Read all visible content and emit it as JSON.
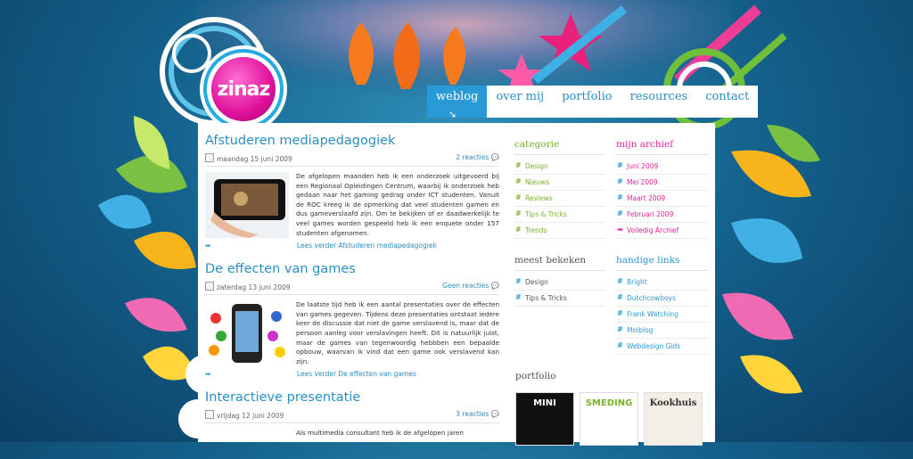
{
  "logo": "zinaz",
  "nav": [
    {
      "label": "weblog",
      "active": true
    },
    {
      "label": "over mij"
    },
    {
      "label": "portfolio"
    },
    {
      "label": "resources"
    },
    {
      "label": "contact"
    }
  ],
  "posts": [
    {
      "title": "Afstuderen mediapedagogiek",
      "date": "maandag 15 juni 2009",
      "reactions": "2 reacties",
      "text": "De afgelopen maanden heb ik een onderzoek uitgevoerd bij een Regionaal Opleidingen Centrum, waarbij ik onderzoek heb gedaan naar het gaming gedrag onder ICT studenten. Vanuit de ROC kreeg ik de opmerking dat veel studenten gamen en dus gameverslaafd zijn. Om te bekijken of er daadwerkelijk te veel games worden gespeeld heb ik een enquete onder 157 studenten afgenomen.",
      "more": "Lees verder Afstuderen mediapedagogiek"
    },
    {
      "title": "De effecten van games",
      "date": "zaterdag 13 juni 2009",
      "reactions": "Geen reacties",
      "text": "De laatste tijd heb ik een aantal presentaties over de effecten van games gegeven. Tijdens deze presentaties ontstaat iedere keer de discussie dat niet de game verslavend is, maar dat de persoon aanleg voor verslavingen heeft. Dit is natuurlijk juist, maar de games van tegenwoordig hebbben een bepaalde opbouw, waarvan ik vind dat een game ook verslavend kan zijn.",
      "more": "Lees verder De effecten van games"
    },
    {
      "title": "Interactieve presentatie",
      "date": "vrijdag 12 juni 2009",
      "reactions": "3 reacties",
      "text": "Als multimedia consultant heb ik de afgelopen jaren",
      "more": ""
    }
  ],
  "categorie": {
    "title": "categorie",
    "items": [
      "Design",
      "Nieuws",
      "Reviews",
      "Tips & Tricks",
      "Trends"
    ]
  },
  "archief": {
    "title": "mijn archief",
    "items": [
      "Juni 2009",
      "Mei 2009",
      "Maart 2009",
      "Februari 2009"
    ],
    "all": "Volledig Archief"
  },
  "meest": {
    "title": "meest bekeken",
    "items": [
      "Design",
      "Tips & Tricks"
    ]
  },
  "links": {
    "title": "handige links",
    "items": [
      "Bright",
      "Dutchcowboys",
      "Frank Watching",
      "Molblog",
      "Webdesign Gids"
    ]
  },
  "portfolio": {
    "title": "portfolio",
    "tiles": [
      "MINI",
      "SMEDING",
      "Kookhuis"
    ]
  },
  "colors": {
    "accent": "#2a9ad6",
    "green": "#7ab32a",
    "pink": "#e0239c"
  }
}
